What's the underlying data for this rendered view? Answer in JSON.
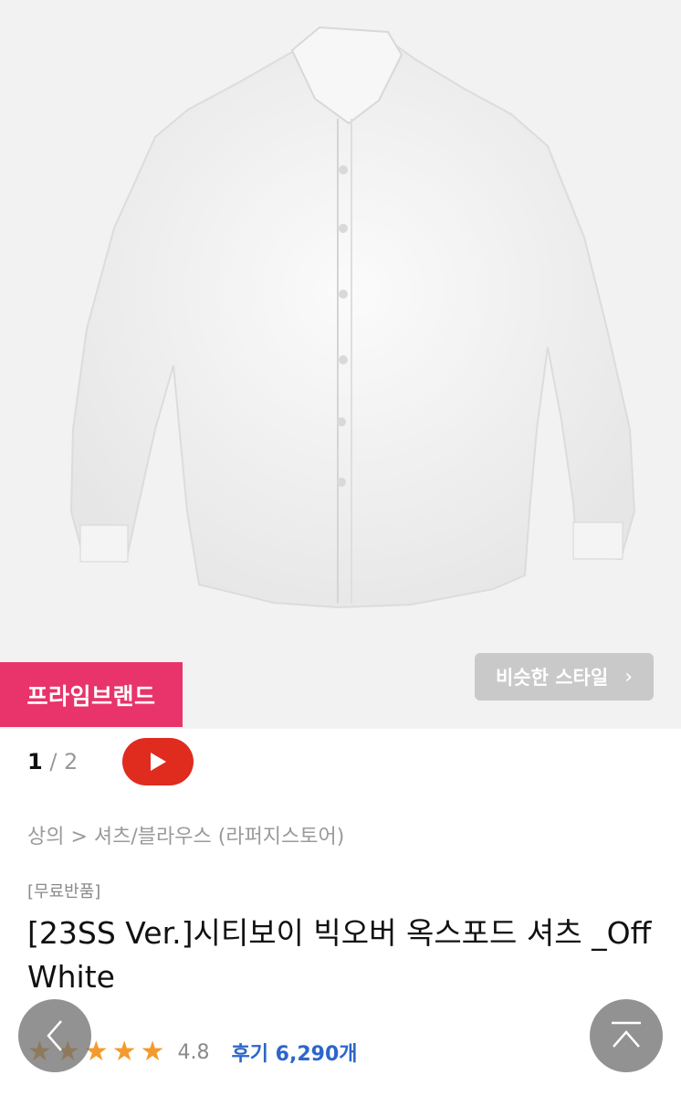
{
  "product_image": {
    "alt": "white oxford shirt"
  },
  "badge": {
    "label": "프라임브랜드",
    "color": "#e8336b"
  },
  "similar_style": {
    "label": "비슷한 스타일",
    "chevron": "›"
  },
  "pager": {
    "current": "1",
    "separator": " / ",
    "total": "2"
  },
  "play_button": {
    "icon": "play-icon",
    "color": "#e02b1f"
  },
  "breadcrumb": {
    "text": "상의 > 셔츠/블라우스 (라퍼지스토어)"
  },
  "tag": {
    "text": "[무료반품]"
  },
  "product": {
    "title": "[23SS Ver.]시티보이 빅오버 옥스포드 셔츠 _Off White"
  },
  "rating": {
    "stars": "★★★★★",
    "value": "4.8",
    "reviews_label": "후기 6,290개",
    "star_color": "#f39a2e"
  },
  "floating": {
    "back_icon": "chevron-left-icon",
    "top_icon": "scroll-top-icon"
  }
}
